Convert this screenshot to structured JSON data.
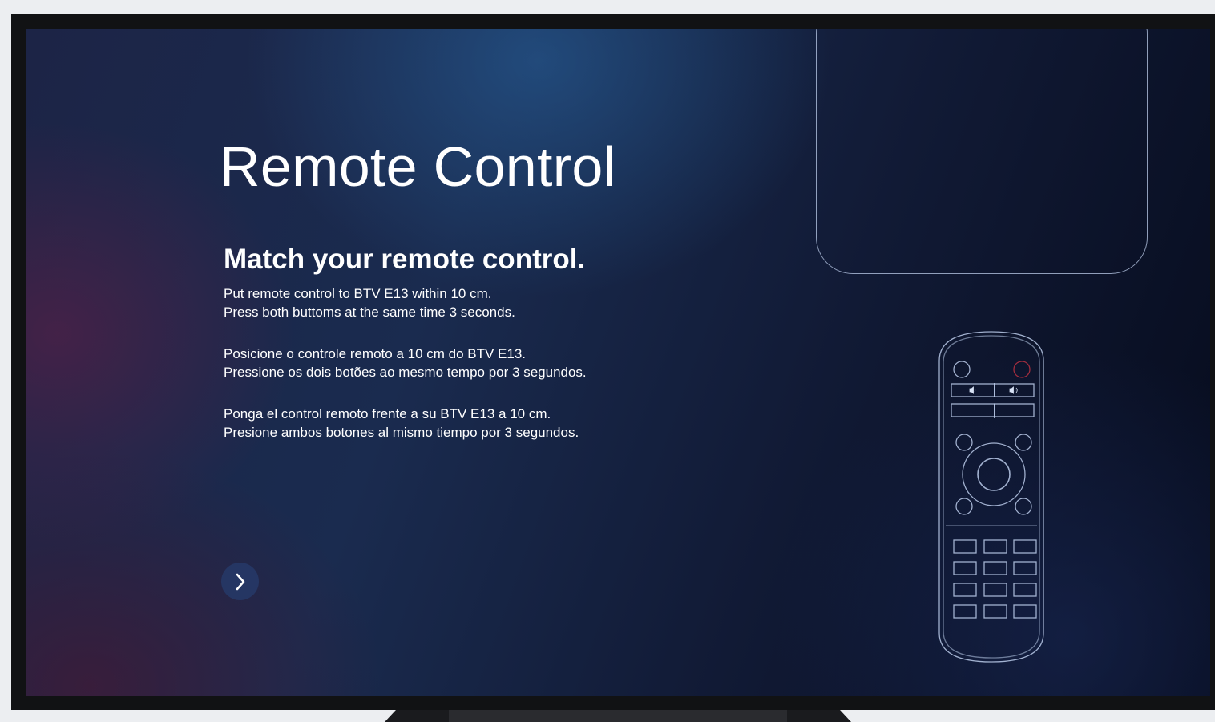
{
  "screen": {
    "title": "Remote Control",
    "subtitle": "Match your remote control.",
    "instructions": [
      {
        "lang": "en",
        "line1": "Put remote control to BTV E13 within 10 cm.",
        "line2": "Press both buttoms at the same time 3 seconds."
      },
      {
        "lang": "pt",
        "line1": "Posicione o controle remoto a 10 cm do BTV E13.",
        "line2": "Pressione os dois botões ao mesmo tempo por 3 segundos."
      },
      {
        "lang": "es",
        "line1": "Ponga el control remoto frente a su BTV E13 a 10 cm.",
        "line2": "Presione ambos botones al mismo tiempo por 3 segundos."
      }
    ],
    "next_button": {
      "icon": "chevron-right-icon"
    }
  },
  "illustration": {
    "device_box": "tv-box-outline",
    "remote": "remote-control-outline",
    "remote_icons": [
      "volume-down-icon",
      "volume-up-icon"
    ]
  },
  "colors": {
    "background_dark": "#0a1024",
    "background_blue": "#1a2b4f",
    "accent_magenta": "#5a1c3c",
    "text": "#ffffff",
    "outline": "#bccdeb",
    "button_bg": "#263a69",
    "remote_power_button": "#b03040"
  }
}
